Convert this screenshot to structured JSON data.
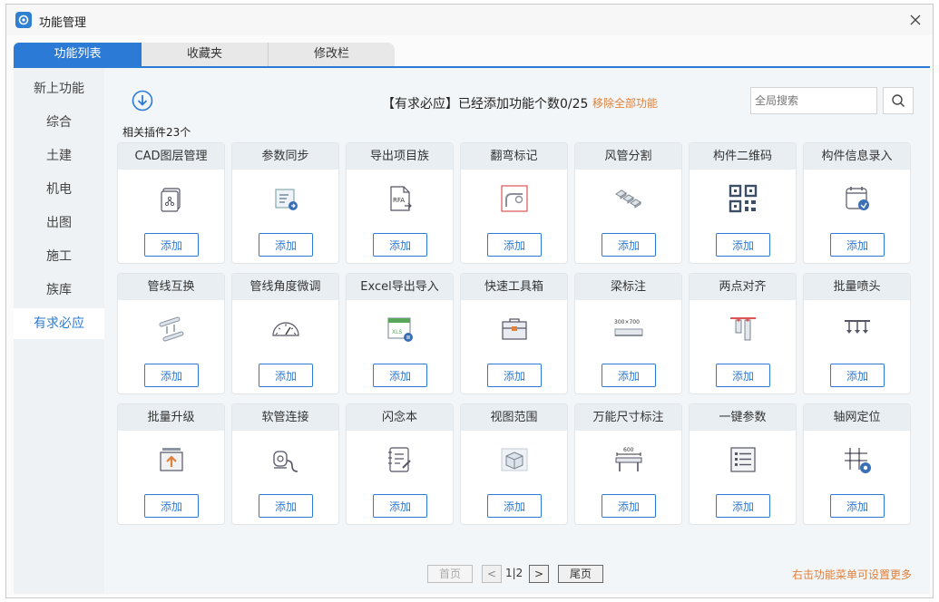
{
  "window": {
    "title": "功能管理"
  },
  "tabs": [
    "功能列表",
    "收藏夹",
    "修改栏"
  ],
  "sidebar": {
    "items": [
      "新上功能",
      "综合",
      "土建",
      "机电",
      "出图",
      "施工",
      "族库",
      "有求必应"
    ],
    "active_index": 7
  },
  "header": {
    "status_text": "【有求必应】已经添加功能个数0/25",
    "remove_all_label": "移除全部功能",
    "search_placeholder": "全局搜索"
  },
  "plugin_count_label": "相关插件23个",
  "add_label": "添加",
  "cards": [
    {
      "title": "CAD图层管理",
      "icon": "cad-layer-icon"
    },
    {
      "title": "参数同步",
      "icon": "param-sync-icon"
    },
    {
      "title": "导出项目族",
      "icon": "rfa-export-icon"
    },
    {
      "title": "翻弯标记",
      "icon": "bend-mark-icon"
    },
    {
      "title": "风管分割",
      "icon": "duct-split-icon"
    },
    {
      "title": "构件二维码",
      "icon": "qr-code-icon"
    },
    {
      "title": "构件信息录入",
      "icon": "info-entry-icon"
    },
    {
      "title": "管线互换",
      "icon": "pipe-swap-icon"
    },
    {
      "title": "管线角度微调",
      "icon": "angle-gauge-icon"
    },
    {
      "title": "Excel导出导入",
      "icon": "excel-xls-icon"
    },
    {
      "title": "快速工具箱",
      "icon": "toolbox-icon"
    },
    {
      "title": "梁标注",
      "icon": "beam-label-icon"
    },
    {
      "title": "两点对齐",
      "icon": "align-points-icon"
    },
    {
      "title": "批量喷头",
      "icon": "sprinkler-icon"
    },
    {
      "title": "批量升级",
      "icon": "upgrade-icon"
    },
    {
      "title": "软管连接",
      "icon": "hose-connect-icon"
    },
    {
      "title": "闪念本",
      "icon": "notebook-icon"
    },
    {
      "title": "视图范围",
      "icon": "view-range-icon"
    },
    {
      "title": "万能尺寸标注",
      "icon": "dimension-icon"
    },
    {
      "title": "一键参数",
      "icon": "param-list-icon"
    },
    {
      "title": "轴网定位",
      "icon": "grid-locate-icon"
    }
  ],
  "icon_text": {
    "rfa": "RFA",
    "xls": "XLS",
    "beam": "300×700",
    "dim": "600"
  },
  "pager": {
    "first_label": "首页",
    "prev_label": "<",
    "page_info": "1|2",
    "next_label": ">",
    "last_label": "尾页"
  },
  "right_hint": "右击功能菜单可设置更多",
  "colors": {
    "accent": "#2b7bd6",
    "warning": "#e0803a"
  }
}
